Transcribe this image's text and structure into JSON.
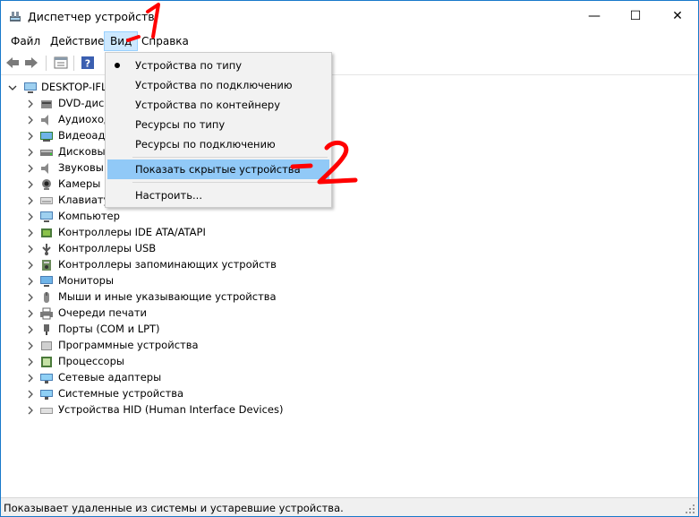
{
  "window": {
    "title": "Диспетчер устройств",
    "controls": {
      "minimize": "—",
      "maximize": "☐",
      "close": "✕"
    }
  },
  "menubar": {
    "items": [
      {
        "label": "Файл"
      },
      {
        "label": "Действие"
      },
      {
        "label": "Вид"
      },
      {
        "label": "Справка"
      }
    ]
  },
  "toolbar": {
    "buttons": [
      "back-icon",
      "forward-icon",
      "properties-icon",
      "help-icon"
    ]
  },
  "tree": {
    "root": "DESKTOP-IFL",
    "items": [
      {
        "label": "DVD-диск",
        "icon": "dvd-icon"
      },
      {
        "label": "Аудиоход",
        "icon": "audio-icon"
      },
      {
        "label": "Видеоад",
        "icon": "display-adapter-icon"
      },
      {
        "label": "Дисковы",
        "icon": "disk-icon"
      },
      {
        "label": "Звуковы",
        "icon": "sound-icon"
      },
      {
        "label": "Камеры",
        "icon": "camera-icon"
      },
      {
        "label": "Клавиату",
        "icon": "keyboard-icon"
      },
      {
        "label": "Компьютер",
        "icon": "computer-icon"
      },
      {
        "label": "Контроллеры IDE ATA/ATAPI",
        "icon": "ide-controller-icon"
      },
      {
        "label": "Контроллеры USB",
        "icon": "usb-icon"
      },
      {
        "label": "Контроллеры запоминающих устройств",
        "icon": "storage-controller-icon"
      },
      {
        "label": "Мониторы",
        "icon": "monitor-icon"
      },
      {
        "label": "Мыши и иные указывающие устройства",
        "icon": "mouse-icon"
      },
      {
        "label": "Очереди печати",
        "icon": "printer-icon"
      },
      {
        "label": "Порты (COM и LPT)",
        "icon": "port-icon"
      },
      {
        "label": "Программные устройства",
        "icon": "software-device-icon"
      },
      {
        "label": "Процессоры",
        "icon": "processor-icon"
      },
      {
        "label": "Сетевые адаптеры",
        "icon": "network-adapter-icon"
      },
      {
        "label": "Системные устройства",
        "icon": "system-device-icon"
      },
      {
        "label": "Устройства HID (Human Interface Devices)",
        "icon": "hid-icon"
      }
    ]
  },
  "view_menu": {
    "items": [
      {
        "label": "Устройства по типу",
        "checked": true
      },
      {
        "label": "Устройства по подключению"
      },
      {
        "label": "Устройства по контейнеру"
      },
      {
        "label": "Ресурсы по типу"
      },
      {
        "label": "Ресурсы по подключению"
      },
      {
        "label": "Показать скрытые устройства",
        "highlighted": true
      },
      {
        "label": "Настроить..."
      }
    ]
  },
  "statusbar": {
    "text": "Показывает удаленные из системы и устаревшие устройства."
  },
  "annotations": {
    "step1": "1",
    "step2": "2",
    "color": "#ff0000"
  },
  "colors": {
    "window_border": "#1979ca",
    "menu_highlight": "#91c9f7",
    "menu_active": "#cce8ff",
    "annotation": "#ff0000"
  }
}
